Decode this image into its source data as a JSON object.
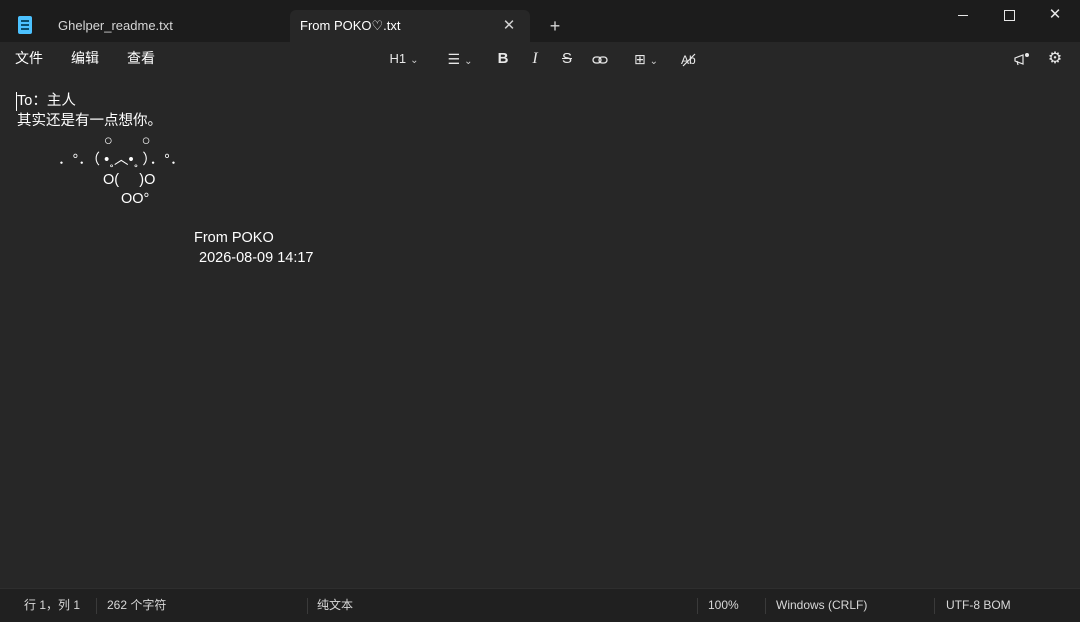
{
  "tabs": [
    {
      "title": "Ghelper_readme.txt",
      "active": false
    },
    {
      "title": "From POKO♡.txt",
      "active": true
    }
  ],
  "window_controls": {
    "close_glyph": "✕",
    "new_tab_glyph": "+"
  },
  "menu": {
    "file": "文件",
    "edit": "编辑",
    "view": "查看"
  },
  "toolbar": {
    "heading": "H1",
    "bold": "B",
    "italic": "I",
    "strike": "S",
    "link_glyph": "⊖",
    "table_glyph": "⊞",
    "spell": "A̶",
    "settings_glyph": "⚙",
    "announce_glyph": "📢",
    "list_glyph": "☰",
    "chevron": "⌄"
  },
  "document": {
    "lines": [
      "To：主人",
      "其实还是有一点想你。",
      "○　　○",
      "．°．（ •˳︿•˳ ）．°．",
      "O(     )O",
      "OO°",
      "From POKO",
      "2026-08-09 14:17"
    ]
  },
  "status": {
    "position": "行 1，列 1",
    "chars": "262 个字符",
    "format": "纯文本",
    "zoom": "100%",
    "line_ending": "Windows (CRLF)",
    "encoding": "UTF-8 BOM"
  }
}
